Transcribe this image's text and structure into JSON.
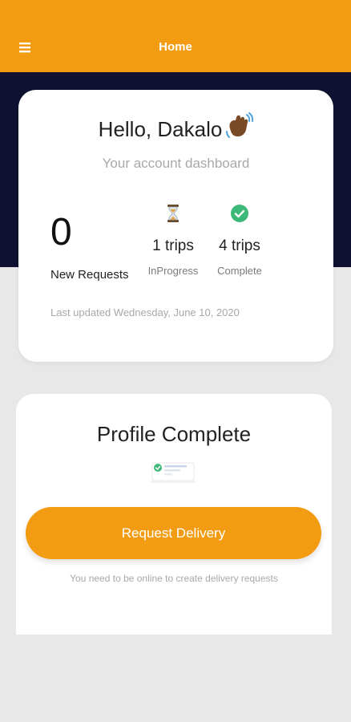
{
  "appbar": {
    "title": "Home",
    "menu_icon": "hamburger-menu-icon",
    "color": "#f39c12"
  },
  "dashboard": {
    "greeting": "Hello, Dakalo",
    "greeting_icon": "waving-hand-icon",
    "subtitle": "Your account dashboard",
    "new_requests": {
      "value": "0",
      "label": "New Requests"
    },
    "in_progress": {
      "icon": "hourglass-icon",
      "value": "1 trips",
      "label": "InProgress"
    },
    "complete": {
      "icon": "check-circle-icon",
      "value": "4 trips",
      "label": "Complete"
    },
    "last_updated": "Last updated Wednesday, June 10, 2020"
  },
  "profile": {
    "title": "Profile Complete",
    "illustration_icon": "profile-checklist-icon",
    "request_button_label": "Request Delivery",
    "online_note": "You need to be online to create delivery requests"
  },
  "colors": {
    "accent": "#f39c12",
    "header_band": "#0e1230",
    "success": "#3cb878",
    "background": "#e8e8e8"
  }
}
